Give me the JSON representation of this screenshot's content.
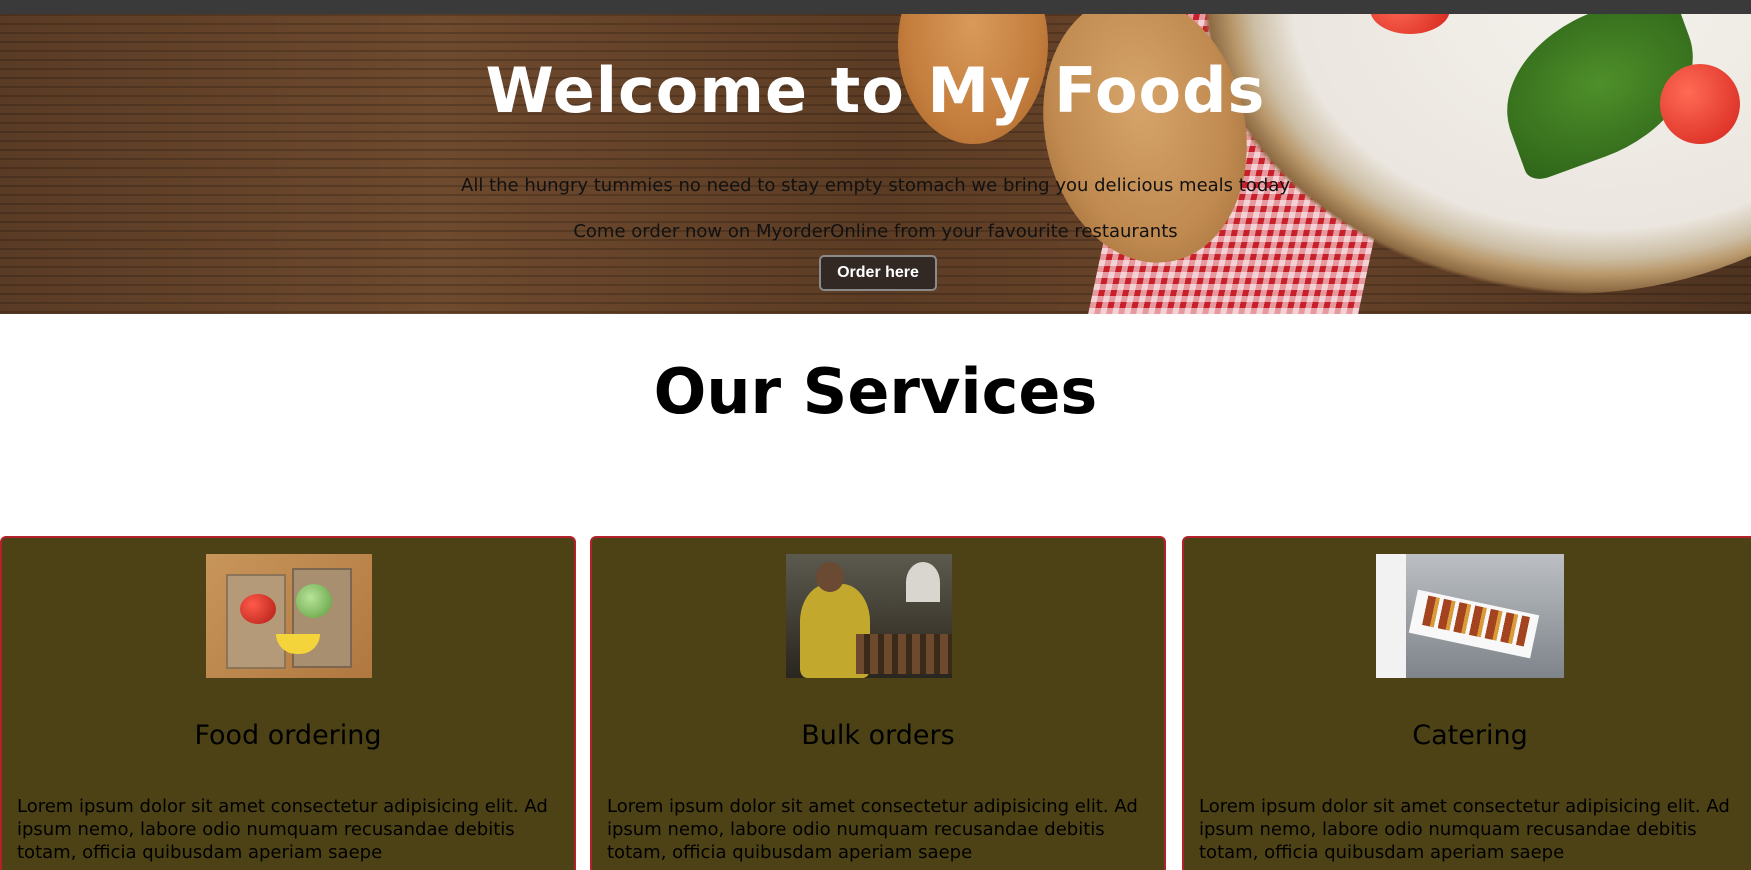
{
  "hero": {
    "title": "Welcome to My Foods",
    "line1": "All the hungry tummies no need to stay empty stomach we bring you delicious meals today",
    "line2": "Come order now on MyorderOnline from your favourite restaurants",
    "button_label": "Order here"
  },
  "services": {
    "title": "Our Services",
    "cards": [
      {
        "title": "Food ordering",
        "text": "Lorem ipsum dolor sit amet consectetur adipisicing elit. Ad ipsum nemo, labore odio numquam recusandae debitis totam, officia quibusdam aperiam saepe"
      },
      {
        "title": "Bulk orders",
        "text": "Lorem ipsum dolor sit amet consectetur adipisicing elit. Ad ipsum nemo, labore odio numquam recusandae debitis totam, officia quibusdam aperiam saepe"
      },
      {
        "title": "Catering",
        "text": "Lorem ipsum dolor sit amet consectetur adipisicing elit. Ad ipsum nemo, labore odio numquam recusandae debitis totam, officia quibusdam aperiam saepe"
      }
    ]
  },
  "colors": {
    "topbar": "#3a3a3a",
    "card_background": "#4c4216",
    "card_border": "#b3222b",
    "button_background": "#322925"
  }
}
